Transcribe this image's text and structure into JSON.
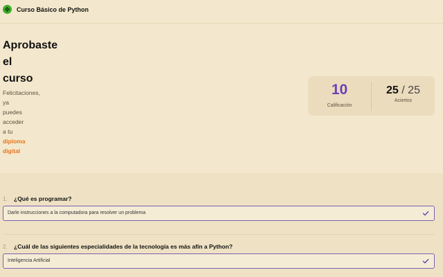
{
  "header": {
    "course_title": "Curso Básico de Python",
    "logo_icon": "python-logo-icon"
  },
  "result": {
    "title_lines": [
      "Aprobaste",
      "el",
      "curso"
    ],
    "message_lines": [
      "Felicitaciones,",
      "ya",
      "puedes",
      "acceder",
      "a tu"
    ],
    "diploma_lines": [
      "diploma",
      "digital"
    ],
    "highlight_color": "#e8731c"
  },
  "score": {
    "grade": "10",
    "grade_label": "Calificación",
    "grade_color": "#6a3fb8",
    "correct": "25",
    "separator": "/",
    "total": "25",
    "hits_label": "Aciertos"
  },
  "questions": [
    {
      "number": "1.",
      "text": "¿Qué es programar?",
      "answer": "Darle instrucciones a la computadora para resolver un problema",
      "status_icon": "check-icon"
    },
    {
      "number": "2.",
      "text": "¿Cuál de las siguientes especialidades de la tecnología es más afín a Python?",
      "answer": "Inteligencia Artificial",
      "status_icon": "check-icon"
    }
  ]
}
